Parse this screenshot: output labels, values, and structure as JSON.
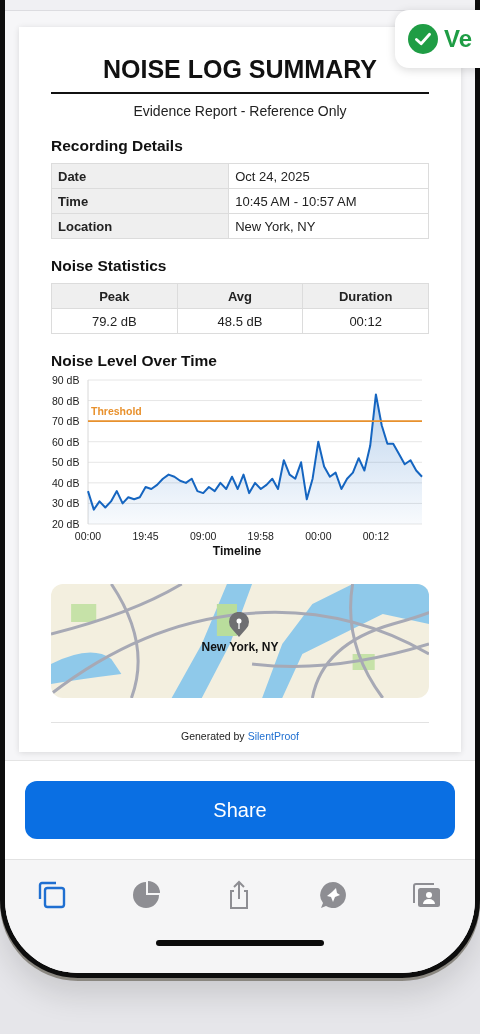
{
  "toast": {
    "text": "Ve"
  },
  "report": {
    "title": "NOISE LOG SUMMARY",
    "subtitle": "Evidence Report - Reference Only",
    "details": {
      "heading": "Recording Details",
      "rows": [
        {
          "label": "Date",
          "value": "Oct 24, 2025"
        },
        {
          "label": "Time",
          "value": "10:45 AM - 10:57 AM"
        },
        {
          "label": "Location",
          "value": "New York, NY"
        }
      ]
    },
    "statistics": {
      "heading": "Noise Statistics",
      "columns": [
        "Peak",
        "Avg",
        "Duration"
      ],
      "values": [
        "79.2 dB",
        "48.5 dB",
        "00:12"
      ]
    },
    "chart": {
      "heading": "Noise Level Over Time",
      "chart_data": {
        "type": "area",
        "xlabel": "Timeline",
        "categories": [
          "00:00",
          null,
          null,
          null,
          null,
          null,
          null,
          null,
          null,
          null,
          "19:45",
          null,
          null,
          null,
          null,
          null,
          null,
          null,
          null,
          null,
          "09:00",
          null,
          null,
          null,
          null,
          null,
          null,
          null,
          null,
          null,
          "19:58",
          null,
          null,
          null,
          null,
          null,
          null,
          null,
          null,
          null,
          "00:00",
          null,
          null,
          null,
          null,
          null,
          null,
          null,
          null,
          null,
          "00:12",
          null,
          null,
          null,
          null,
          null,
          null,
          null,
          null
        ],
        "series": [
          {
            "color": "#1565c0",
            "values": [
              36,
              27,
              31,
              28,
              31,
              36,
              30,
              33,
              32,
              33,
              38,
              37,
              39,
              42,
              44,
              43,
              41,
              40,
              42,
              36,
              35,
              38,
              36,
              40,
              37,
              43,
              37,
              44,
              35,
              40,
              37,
              39,
              42,
              37,
              51,
              44,
              42,
              50,
              32,
              42,
              60,
              48,
              43,
              45,
              37,
              42,
              45,
              52,
              46,
              58,
              83,
              68,
              59,
              59,
              54,
              49,
              51,
              46,
              43
            ]
          }
        ],
        "ylim": [
          20,
          90
        ],
        "yticks": [
          {
            "value": 20,
            "label": "20 dB"
          },
          {
            "value": 30,
            "label": "30 dB"
          },
          {
            "value": 40,
            "label": "40 dB"
          },
          {
            "value": 50,
            "label": "50 dB"
          },
          {
            "value": 60,
            "label": "60 dB"
          },
          {
            "value": 70,
            "label": "70 dB"
          },
          {
            "value": 80,
            "label": "80 dB"
          },
          {
            "value": 90,
            "label": "90 dB"
          }
        ],
        "grid": true,
        "ref_lines": [
          {
            "axis": "y",
            "value": 70,
            "label": "Threshold",
            "color": "#e8912d"
          }
        ]
      }
    },
    "map": {
      "label": "New York, NY"
    },
    "footer": {
      "prefix": "Generated by",
      "link": "SilentProof"
    }
  },
  "share_button": {
    "label": "Share"
  },
  "tab_bar": {
    "items": [
      {
        "selected": true
      },
      {
        "selected": false
      },
      {
        "selected": false
      },
      {
        "selected": false
      },
      {
        "selected": false
      }
    ]
  }
}
